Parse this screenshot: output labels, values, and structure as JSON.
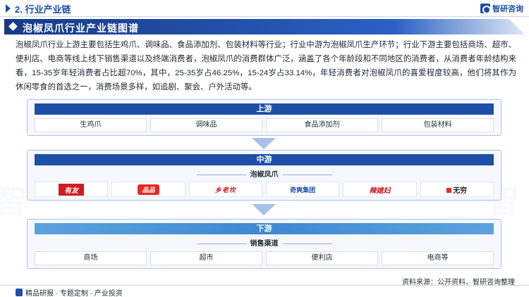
{
  "header": {
    "section_title": "2. 行业产业链",
    "logo_text": "智研咨询"
  },
  "title_bar": {
    "title": "泡椒凤爪行业产业链图谱"
  },
  "paragraph": "泡椒凤爪行业上游主要包括生鸡爪、调味品、食品添加剂、包装材料等行业；行业中游为泡椒凤爪生产环节；行业下游主要包括商场、超市、便利店、电商等线上线下销售渠道以及终端消费者，泡椒凤爪的消费群体广泛，涵盖了各个年龄段和不同地区的消费者，从消费者年龄结构来看，15-35岁年轻消费者占比超70%，其中，25-35岁占46.25%，15-24岁占33.14%，年轻消费者对泡椒凤爪的喜爱程度较高，他们将其作为休闲零食的首选之一，消费场景多样，如追剧、聚会、户外活动等。",
  "upstream": {
    "label": "上游",
    "items": [
      "生鸡爪",
      "调味品",
      "食品添加剂",
      "包装材料"
    ]
  },
  "midstream": {
    "label": "中游",
    "product": "泡椒凤爪",
    "brands": [
      "有友",
      "品品",
      "乡老坎",
      "奇爽集团",
      "辣媳妇",
      "无穷"
    ],
    "brand_sublabel": "QISHUANG GROUP"
  },
  "downstream": {
    "label": "下游",
    "channel_label": "销售渠道",
    "items": [
      "商场",
      "超市",
      "便利店",
      "电商等"
    ]
  },
  "footer": {
    "left_text": "精品研报 · 专题定制 · 产业投资",
    "source": "资料来源：公开资料、智研咨询整理"
  },
  "colors": {
    "primary": "#1e4fa8",
    "accent_light": "#5aa3dd",
    "panel_border": "#a9c1e6"
  },
  "icons": [
    "section-bullet-icon",
    "logo-icon",
    "title-diamond-icon",
    "down-arrow-icon",
    "report-icon"
  ]
}
